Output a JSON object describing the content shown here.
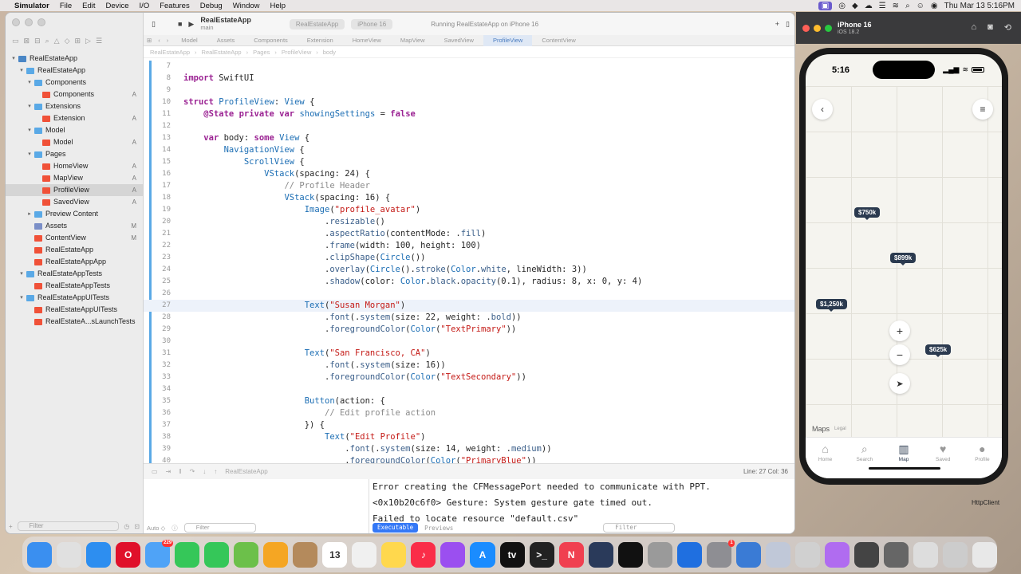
{
  "menubar": {
    "app": "Simulator",
    "items": [
      "File",
      "Edit",
      "Device",
      "I/O",
      "Features",
      "Debug",
      "Window",
      "Help"
    ],
    "datetime": "Thu Mar 13  5:16PM"
  },
  "xcode": {
    "scheme": "RealEstateApp",
    "branch": "main",
    "run_destination": {
      "scheme": "RealEstateApp",
      "device": "iPhone 16"
    },
    "status": "Running RealEstateApp on iPhone 16",
    "tabs": [
      {
        "label": "Model",
        "active": false
      },
      {
        "label": "Assets",
        "active": false
      },
      {
        "label": "Components",
        "active": false
      },
      {
        "label": "Extension",
        "active": false
      },
      {
        "label": "HomeView",
        "active": false
      },
      {
        "label": "MapView",
        "active": false
      },
      {
        "label": "SavedView",
        "active": false
      },
      {
        "label": "ProfileView",
        "active": true
      },
      {
        "label": "ContentView",
        "active": false
      }
    ],
    "jumpbar": [
      "RealEstateApp",
      "RealEstateApp",
      "Pages",
      "ProfileView",
      "body"
    ],
    "navigator": [
      {
        "label": "RealEstateApp",
        "indent": 0,
        "disc": "▾",
        "kind": "proj",
        "badge": ""
      },
      {
        "label": "RealEstateApp",
        "indent": 1,
        "disc": "▾",
        "kind": "folder",
        "badge": ""
      },
      {
        "label": "Components",
        "indent": 2,
        "disc": "▾",
        "kind": "folder",
        "badge": ""
      },
      {
        "label": "Components",
        "indent": 3,
        "disc": "",
        "kind": "swift",
        "badge": "A"
      },
      {
        "label": "Extensions",
        "indent": 2,
        "disc": "▾",
        "kind": "folder",
        "badge": ""
      },
      {
        "label": "Extension",
        "indent": 3,
        "disc": "",
        "kind": "swift",
        "badge": "A"
      },
      {
        "label": "Model",
        "indent": 2,
        "disc": "▾",
        "kind": "folder",
        "badge": ""
      },
      {
        "label": "Model",
        "indent": 3,
        "disc": "",
        "kind": "swift",
        "badge": "A"
      },
      {
        "label": "Pages",
        "indent": 2,
        "disc": "▾",
        "kind": "folder",
        "badge": ""
      },
      {
        "label": "HomeView",
        "indent": 3,
        "disc": "",
        "kind": "swift",
        "badge": "A"
      },
      {
        "label": "MapView",
        "indent": 3,
        "disc": "",
        "kind": "swift",
        "badge": "A"
      },
      {
        "label": "ProfileView",
        "indent": 3,
        "disc": "",
        "kind": "swift",
        "badge": "A",
        "selected": true
      },
      {
        "label": "SavedView",
        "indent": 3,
        "disc": "",
        "kind": "swift",
        "badge": "A"
      },
      {
        "label": "Preview Content",
        "indent": 2,
        "disc": "▸",
        "kind": "folder",
        "badge": ""
      },
      {
        "label": "Assets",
        "indent": 2,
        "disc": "",
        "kind": "asset",
        "badge": "M"
      },
      {
        "label": "ContentView",
        "indent": 2,
        "disc": "",
        "kind": "swift",
        "badge": "M"
      },
      {
        "label": "RealEstateApp",
        "indent": 2,
        "disc": "",
        "kind": "swift",
        "badge": ""
      },
      {
        "label": "RealEstateAppApp",
        "indent": 2,
        "disc": "",
        "kind": "swift",
        "badge": ""
      },
      {
        "label": "RealEstateAppTests",
        "indent": 1,
        "disc": "▾",
        "kind": "folder",
        "badge": ""
      },
      {
        "label": "RealEstateAppTests",
        "indent": 2,
        "disc": "",
        "kind": "swift",
        "badge": ""
      },
      {
        "label": "RealEstateAppUITests",
        "indent": 1,
        "disc": "▾",
        "kind": "folder",
        "badge": ""
      },
      {
        "label": "RealEstateAppUITests",
        "indent": 2,
        "disc": "",
        "kind": "swift",
        "badge": ""
      },
      {
        "label": "RealEstateA...sLaunchTests",
        "indent": 2,
        "disc": "",
        "kind": "swift",
        "badge": ""
      }
    ],
    "nav_filter_placeholder": "Filter",
    "code": [
      {
        "n": "7",
        "html": ""
      },
      {
        "n": "8",
        "html": "<span class='k'>import</span> SwiftUI"
      },
      {
        "n": "9",
        "html": ""
      },
      {
        "n": "10",
        "html": "<span class='k'>struct</span> <span class='t'>ProfileView</span>: <span class='t'>View</span> {"
      },
      {
        "n": "11",
        "html": "    <span class='k'>@State</span> <span class='k'>private</span> <span class='k'>var</span> <span class='t'>showingSettings</span> = <span class='k'>false</span>"
      },
      {
        "n": "12",
        "html": ""
      },
      {
        "n": "13",
        "html": "    <span class='k'>var</span> body: <span class='k'>some</span> <span class='t'>View</span> {"
      },
      {
        "n": "14",
        "html": "        <span class='t'>NavigationView</span> {"
      },
      {
        "n": "15",
        "html": "            <span class='t'>ScrollView</span> {"
      },
      {
        "n": "16",
        "html": "                <span class='t'>VStack</span>(spacing: 24) {"
      },
      {
        "n": "17",
        "html": "                    <span class='c'>// Profile Header</span>"
      },
      {
        "n": "18",
        "html": "                    <span class='t'>VStack</span>(spacing: 16) {"
      },
      {
        "n": "19",
        "html": "                        <span class='t'>Image</span>(<span class='s'>\"profile_avatar\"</span>)"
      },
      {
        "n": "20",
        "html": "                            .<span class='f'>resizable</span>()"
      },
      {
        "n": "21",
        "html": "                            .<span class='f'>aspectRatio</span>(contentMode: .<span class='f'>fill</span>)"
      },
      {
        "n": "22",
        "html": "                            .<span class='f'>frame</span>(width: 100, height: 100)"
      },
      {
        "n": "23",
        "html": "                            .<span class='f'>clipShape</span>(<span class='t'>Circle</span>())"
      },
      {
        "n": "24",
        "html": "                            .<span class='f'>overlay</span>(<span class='t'>Circle</span>().<span class='f'>stroke</span>(<span class='t'>Color</span>.<span class='f'>white</span>, lineWidth: 3))"
      },
      {
        "n": "25",
        "html": "                            .<span class='f'>shadow</span>(color: <span class='t'>Color</span>.<span class='f'>black</span>.<span class='f'>opacity</span>(0.1), radius: 8, x: 0, y: 4)"
      },
      {
        "n": "26",
        "html": ""
      },
      {
        "n": "27",
        "html": "                        <span class='t'>Text</span>(<span class='s'>\"Susan Morgan\"</span>)",
        "current": true
      },
      {
        "n": "28",
        "html": "                            .<span class='f'>font</span>(.<span class='f'>system</span>(size: 22, weight: .<span class='f'>bold</span>))"
      },
      {
        "n": "29",
        "html": "                            .<span class='f'>foregroundColor</span>(<span class='t'>Color</span>(<span class='s'>\"TextPrimary\"</span>))"
      },
      {
        "n": "30",
        "html": ""
      },
      {
        "n": "31",
        "html": "                        <span class='t'>Text</span>(<span class='s'>\"San Francisco, CA\"</span>)"
      },
      {
        "n": "32",
        "html": "                            .<span class='f'>font</span>(.<span class='f'>system</span>(size: 16))"
      },
      {
        "n": "33",
        "html": "                            .<span class='f'>foregroundColor</span>(<span class='t'>Color</span>(<span class='s'>\"TextSecondary\"</span>))"
      },
      {
        "n": "34",
        "html": ""
      },
      {
        "n": "35",
        "html": "                        <span class='t'>Button</span>(action: {"
      },
      {
        "n": "36",
        "html": "                            <span class='c'>// Edit profile action</span>"
      },
      {
        "n": "37",
        "html": "                        }) {"
      },
      {
        "n": "38",
        "html": "                            <span class='t'>Text</span>(<span class='s'>\"Edit Profile\"</span>)"
      },
      {
        "n": "39",
        "html": "                                .<span class='f'>font</span>(.<span class='f'>system</span>(size: 14, weight: .<span class='f'>medium</span>))"
      },
      {
        "n": "40",
        "html": "                                .<span class='f'>foregroundColor</span>(<span class='t'>Color</span>(<span class='s'>\"PrimaryBlue\"</span>))"
      }
    ],
    "line_col": "Line: 27  Col: 36",
    "debug_target": "RealEstateApp",
    "console": [
      "Error creating the CFMessagePort needed to communicate with PPT.",
      "<0x10b20c6f0> Gesture: System gesture gate timed out.",
      "Failed to locate resource \"default.csv\""
    ],
    "auto_label": "Auto ◇",
    "vars_filter_placeholder": "Filter",
    "console_filter_placeholder": "Filter",
    "executable_tab": "Executable",
    "previews_tab": "Previews"
  },
  "simulator": {
    "device": "iPhone 16",
    "os": "iOS 18.2",
    "time": "5:16",
    "pins": [
      {
        "label": "$750k"
      },
      {
        "label": "$899k"
      },
      {
        "label": "$1,250k"
      },
      {
        "label": "$625k"
      }
    ],
    "maps_label": "Maps",
    "legal_label": "Legal",
    "tabbar": [
      {
        "label": "Home",
        "icon": "house-icon",
        "glyph": "⌂",
        "active": false
      },
      {
        "label": "Search",
        "icon": "magnifier-icon",
        "glyph": "⌕",
        "active": false
      },
      {
        "label": "Map",
        "icon": "map-icon",
        "glyph": "▥",
        "active": true
      },
      {
        "label": "Saved",
        "icon": "heart-icon",
        "glyph": "♥",
        "active": false
      },
      {
        "label": "Profile",
        "icon": "person-icon",
        "glyph": "●",
        "active": false
      }
    ]
  },
  "dock": {
    "items": [
      {
        "name": "finder",
        "color": "#3a8ff0",
        "glyph": ""
      },
      {
        "name": "launchpad",
        "color": "#e0e0e0",
        "glyph": ""
      },
      {
        "name": "safari",
        "color": "#2d8ef0",
        "glyph": ""
      },
      {
        "name": "opera",
        "color": "#e0102a",
        "glyph": "O"
      },
      {
        "name": "mail",
        "color": "#4fa3f7",
        "glyph": "",
        "badge": "229"
      },
      {
        "name": "facetime",
        "color": "#35c759",
        "glyph": ""
      },
      {
        "name": "messages",
        "color": "#35c759",
        "glyph": ""
      },
      {
        "name": "maps",
        "color": "#6cc04a",
        "glyph": ""
      },
      {
        "name": "photos",
        "color": "#f5a623",
        "glyph": ""
      },
      {
        "name": "contacts",
        "color": "#b48a5c",
        "glyph": ""
      },
      {
        "name": "calendar",
        "color": "#ffffff",
        "glyph": "13"
      },
      {
        "name": "reminders",
        "color": "#f0f0f0",
        "glyph": ""
      },
      {
        "name": "notes",
        "color": "#ffd84d",
        "glyph": ""
      },
      {
        "name": "music",
        "color": "#fa2d48",
        "glyph": "♪"
      },
      {
        "name": "podcasts",
        "color": "#9b4ff0",
        "glyph": ""
      },
      {
        "name": "appstore",
        "color": "#1a8cff",
        "glyph": "A"
      },
      {
        "name": "tv",
        "color": "#111111",
        "glyph": "tv"
      },
      {
        "name": "terminal",
        "color": "#222222",
        "glyph": ">_"
      },
      {
        "name": "news",
        "color": "#f04050",
        "glyph": "N"
      },
      {
        "name": "instruments",
        "color": "#2a3a5a",
        "glyph": ""
      },
      {
        "name": "capcut",
        "color": "#111111",
        "glyph": ""
      },
      {
        "name": "database",
        "color": "#9a9a9a",
        "glyph": ""
      },
      {
        "name": "xcode",
        "color": "#1f6fe0",
        "glyph": ""
      },
      {
        "name": "settings",
        "color": "#8e8e93",
        "glyph": "",
        "badge": "1"
      },
      {
        "name": "simulator",
        "color": "#3a7bd5",
        "glyph": ""
      },
      {
        "name": "preview",
        "color": "#c0c8d8",
        "glyph": ""
      },
      {
        "name": "keychain",
        "color": "#d0d0d0",
        "glyph": ""
      },
      {
        "name": "siri",
        "color": "#b06cf0",
        "glyph": ""
      },
      {
        "name": "screenshot1",
        "color": "#444444",
        "glyph": ""
      },
      {
        "name": "screenshot2",
        "color": "#666666",
        "glyph": ""
      },
      {
        "name": "screenshot3",
        "color": "#dddddd",
        "glyph": ""
      },
      {
        "name": "screenshot4",
        "color": "#cccccc",
        "glyph": ""
      },
      {
        "name": "trash",
        "color": "#e8e8e8",
        "glyph": ""
      }
    ]
  },
  "desktop_label": "HttpClient"
}
